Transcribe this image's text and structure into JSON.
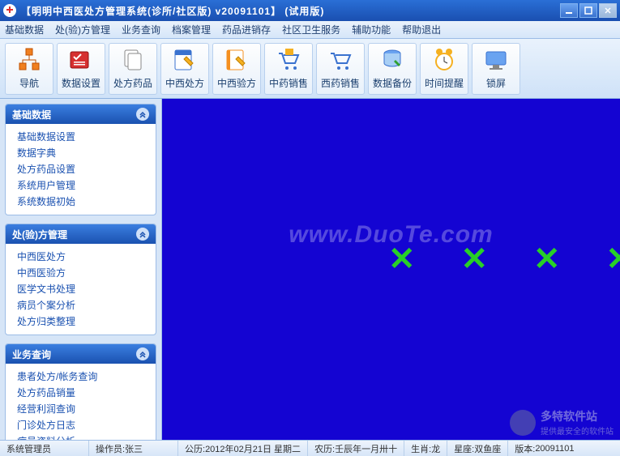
{
  "window": {
    "title": "【明明中西医处方管理系统(诊所/社区版)  v20091101】 (试用版)"
  },
  "menu": [
    "基础数据",
    "处(验)方管理",
    "业务查询",
    "档案管理",
    "药品进销存",
    "社区卫生服务",
    "辅助功能",
    "帮助退出"
  ],
  "toolbar": [
    {
      "label": "导航",
      "icon": "nav"
    },
    {
      "label": "数据设置",
      "icon": "datasettings"
    },
    {
      "label": "处方药品",
      "icon": "drugs"
    },
    {
      "label": "中西处方",
      "icon": "rx1"
    },
    {
      "label": "中西验方",
      "icon": "rx2"
    },
    {
      "label": "中药销售",
      "icon": "sale1"
    },
    {
      "label": "西药销售",
      "icon": "sale2"
    },
    {
      "label": "数据备份",
      "icon": "backup"
    },
    {
      "label": "时间提醒",
      "icon": "clock"
    },
    {
      "label": "锁屏",
      "icon": "lock"
    }
  ],
  "sidebar": [
    {
      "title": "基础数据",
      "items": [
        "基础数据设置",
        "数据字典",
        "处方药品设置",
        "系统用户管理",
        "系统数据初始"
      ]
    },
    {
      "title": "处(验)方管理",
      "items": [
        "中西医处方",
        "中西医验方",
        "医学文书处理",
        "病员个案分析",
        "处方归类整理"
      ]
    },
    {
      "title": "业务查询",
      "items": [
        "患者处方/帐务查询",
        "处方药品销量",
        "经营利润查询",
        "门诊处方日志",
        "病员资料分析"
      ]
    }
  ],
  "content": {
    "watermark": "www.DuoTe.com",
    "brand": "多特软件站",
    "brand_sub": "提供最安全的软件站"
  },
  "status": {
    "role": "系统管理员",
    "operator_label": "操作员:",
    "operator": "张三",
    "solar_label": "公历:",
    "solar": "2012年02月21日 星期二",
    "lunar_label": "农历:",
    "lunar": "壬辰年一月卅十",
    "zodiac_label": "生肖:",
    "zodiac": "龙",
    "constellation_label": "星座:",
    "constellation": "双鱼座",
    "version_label": "版本:",
    "version": "20091101"
  }
}
